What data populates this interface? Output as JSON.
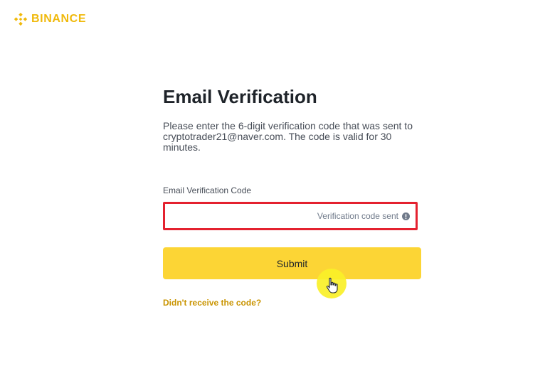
{
  "brand": {
    "name": "BINANCE",
    "icon": "binance-logo-icon",
    "color": "#f0b90b"
  },
  "form": {
    "title": "Email Verification",
    "description": "Please enter the 6-digit verification code that was sent to cryptotrader21@naver.com. The code is valid for 30 minutes.",
    "code_field": {
      "label": "Email Verification Code",
      "value": "",
      "placeholder": "",
      "status_text": "Verification code sent",
      "status_icon": "info-icon",
      "border_color": "#e4212f"
    },
    "submit_label": "Submit",
    "resend_link": "Didn't receive the code?"
  },
  "colors": {
    "accent": "#fcd535",
    "link": "#c99400",
    "text": "#1e2329",
    "muted": "#707a8a"
  },
  "cursor": {
    "icon": "hand-pointer-icon",
    "highlight_color": "#faf028"
  }
}
